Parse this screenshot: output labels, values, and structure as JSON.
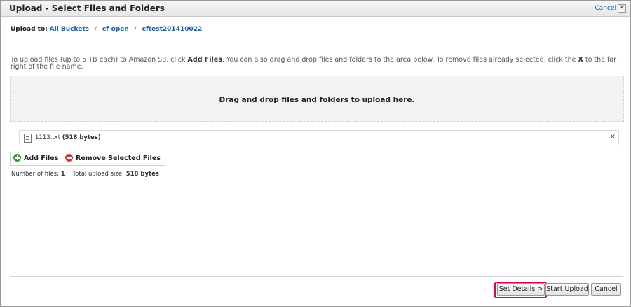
{
  "dialog": {
    "title": "Upload - Select Files and Folders",
    "cancel_link": "Cancel",
    "close_glyph": "✕"
  },
  "breadcrumb": {
    "label": "Upload to:",
    "items": [
      "All Buckets",
      "cf-open",
      "cftest201410022"
    ],
    "separator": "/"
  },
  "instructions": {
    "part1": "To upload files (up to 5 TB each) to Amazon S3, click ",
    "bold1": "Add Files",
    "part2": ". You can also drag and drop files and folders to the area below. To remove files already selected, click the ",
    "bold2": "X",
    "part3": " to the far right of the file name."
  },
  "dropzone": {
    "text": "Drag and drop files and folders to upload here."
  },
  "files": [
    {
      "name": "1113.txt",
      "size": "(518 bytes)",
      "icon": "document-icon",
      "remove_glyph": "×"
    }
  ],
  "actions": {
    "add_files": "Add Files",
    "remove_selected": "Remove Selected Files"
  },
  "stats": {
    "count_label": "Number of files:",
    "count_value": "1",
    "size_label": "Total upload size:",
    "size_value": "518 bytes"
  },
  "footer": {
    "set_details": "Set Details >",
    "start_upload": "Start Upload",
    "cancel": "Cancel"
  },
  "colors": {
    "link": "#1a5fa8",
    "highlight": "#e0005e",
    "add_icon": "#2f9a2f",
    "remove_icon": "#d23a2a",
    "dropzone_bg": "#f2f2f2"
  }
}
